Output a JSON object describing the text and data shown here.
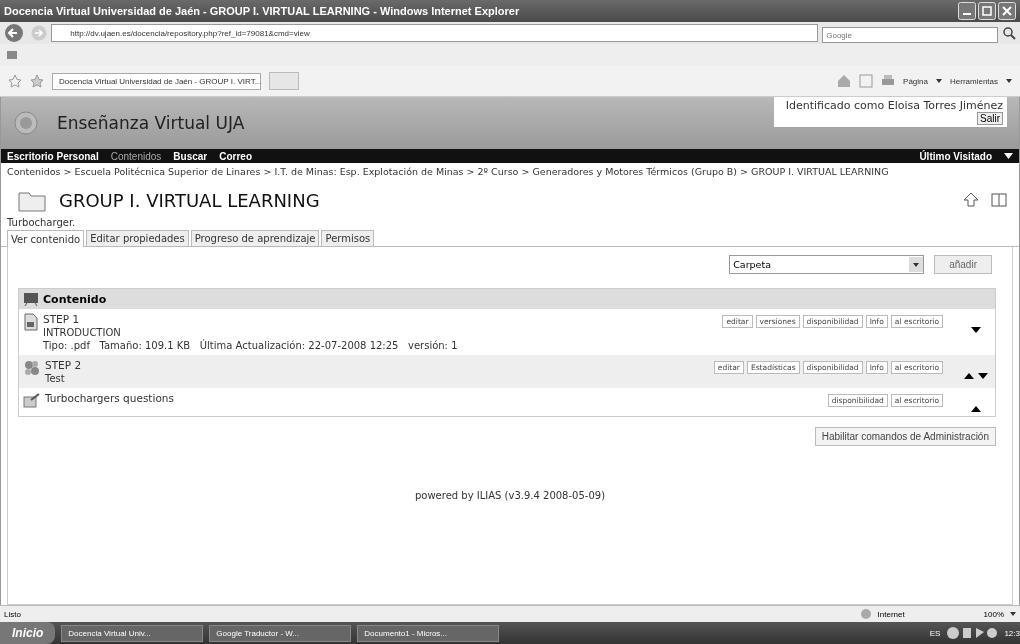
{
  "window": {
    "title": "Docencia Virtual Universidad de Jaén - GROUP I. VIRTUAL LEARNING - Windows Internet Explorer"
  },
  "address_bar": {
    "url": "http://dv.ujaen.es/docencia/repository.php?ref_id=79081&cmd=view",
    "search_placeholder": "Google"
  },
  "browser_tab": {
    "title": "Docencia Virtual Universidad de Jaén - GROUP I. VIRT..."
  },
  "command_bar": [
    "Página",
    "Herramientas"
  ],
  "site": {
    "name": "Enseñanza Virtual UJA",
    "user": "Identificado como Eloisa Torres Jiménez",
    "logout": "Salir"
  },
  "nav": {
    "items": [
      {
        "label": "Escritorio Personal",
        "selected": false
      },
      {
        "label": "Contenidos",
        "selected": true
      },
      {
        "label": "Buscar",
        "selected": false
      },
      {
        "label": "Correo",
        "selected": false
      }
    ],
    "last_visited": "Último Visitado"
  },
  "breadcrumb": "Contenidos > Escuela Politécnica Superior de Linares > I.T. de Minas: Esp. Explotación de Minas > 2º Curso > Generadores y Motores Térmicos (Grupo B) > GROUP I. VIRTUAL LEARNING",
  "page": {
    "title": "GROUP I. VIRTUAL LEARNING",
    "description": "Turbocharger."
  },
  "tabs": [
    {
      "label": "Ver contenido",
      "selected": true
    },
    {
      "label": "Editar propiedades",
      "selected": false
    },
    {
      "label": "Progreso de aprendizaje",
      "selected": false
    },
    {
      "label": "Permisos",
      "selected": false
    }
  ],
  "add": {
    "type_value": "Carpeta",
    "button": "añadir"
  },
  "content": {
    "header": "Contenido",
    "items": [
      {
        "kind": "file",
        "title": "STEP 1",
        "subtitle": "INTRODUCTION",
        "meta": "Tipo: .pdf   Tamaño: 109.1 KB   Última Actualización: 22-07-2008 12:25   versión: 1",
        "actions": [
          "editar",
          "versiones",
          "disponibilidad",
          "Info",
          "al escritorio"
        ],
        "can_move_up": false,
        "can_move_down": true
      },
      {
        "kind": "test",
        "title": "STEP 2",
        "subtitle": "Test",
        "actions": [
          "editar",
          "Estadísticas",
          "disponibilidad",
          "Info",
          "al escritorio"
        ],
        "can_move_up": true,
        "can_move_down": true
      },
      {
        "kind": "survey",
        "title": "Turbochargers questions",
        "actions": [
          "disponibilidad",
          "al escritorio"
        ],
        "can_move_up": true,
        "can_move_down": false
      }
    ]
  },
  "admin_button": "Habilitar comandos de Administración",
  "footer": "powered by ILIAS (v3.9.4 2008-05-09)",
  "status_bar": {
    "status": "Listo",
    "zone": "Internet",
    "zoom": "100%"
  },
  "taskbar": {
    "start": "Inicio",
    "tasks": [
      "Docencia Virtual Univ...",
      "Google Traductor - W...",
      "Documento1 - Micros..."
    ],
    "language": "ES",
    "clock": "12:3"
  }
}
